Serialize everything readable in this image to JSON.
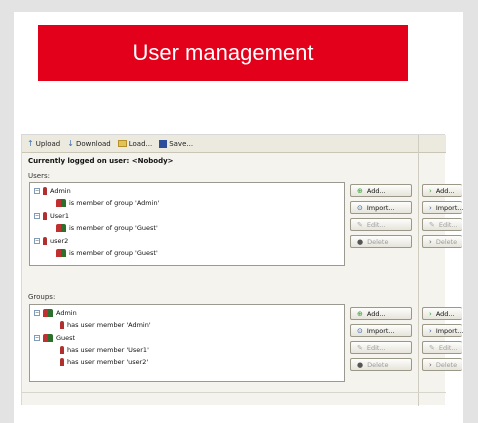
{
  "banner": {
    "title": "User management"
  },
  "toolbar": {
    "upload": "Upload",
    "download": "Download",
    "load": "Load...",
    "save": "Save..."
  },
  "logged_on": "Currently logged on user: <Nobody>",
  "users": {
    "label": "Users:",
    "tree": [
      {
        "kind": "user",
        "label": "Admin",
        "expander": "−"
      },
      {
        "kind": "group",
        "label": "is member of group 'Admin'"
      },
      {
        "kind": "user",
        "label": "User1",
        "expander": "−"
      },
      {
        "kind": "group",
        "label": "is member of group 'Guest'"
      },
      {
        "kind": "user",
        "label": "user2",
        "expander": "−"
      },
      {
        "kind": "group",
        "label": "is member of group 'Guest'"
      }
    ],
    "buttons": {
      "add": "Add...",
      "import": "Import...",
      "edit": "Edit...",
      "delete": "Delete"
    }
  },
  "groups": {
    "label": "Groups:",
    "tree": [
      {
        "kind": "group",
        "label": "Admin",
        "expander": "−"
      },
      {
        "kind": "user",
        "label": "has user member 'Admin'"
      },
      {
        "kind": "group",
        "label": "Guest",
        "expander": "−"
      },
      {
        "kind": "user",
        "label": "has user member 'User1'"
      },
      {
        "kind": "user",
        "label": "has user member 'user2'"
      }
    ],
    "buttons": {
      "add": "Add...",
      "import": "Import...",
      "edit": "Edit...",
      "delete": "Delete"
    }
  },
  "icons": {
    "upload": "arrow-up-icon",
    "download": "arrow-down-icon",
    "load": "folder-icon",
    "save": "floppy-disk-icon",
    "add": "plus-icon",
    "import": "import-icon",
    "edit": "edit-icon",
    "delete": "delete-icon",
    "user": "user-icon",
    "group": "group-icon"
  },
  "colors": {
    "banner": "#e2001a",
    "background": "#e3e3e3"
  }
}
